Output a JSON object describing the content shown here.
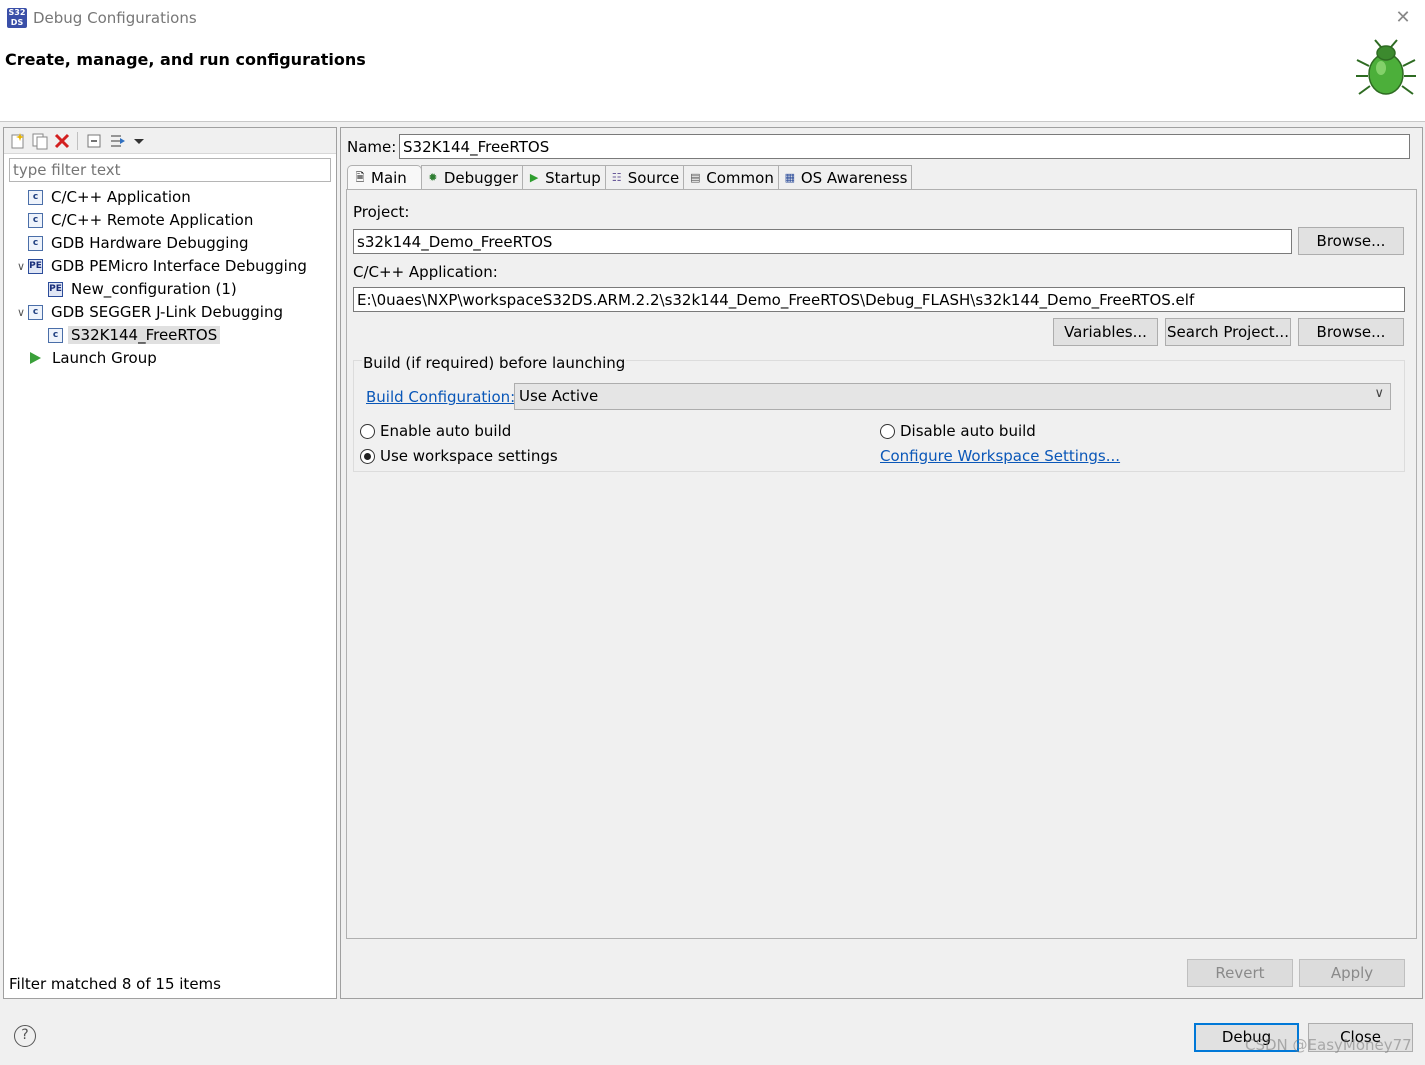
{
  "window": {
    "title": "Debug Configurations",
    "header_title": "Create, manage, and run configurations"
  },
  "left": {
    "filter_placeholder": "type filter text",
    "tree": [
      {
        "label": "C/C++ Application",
        "icon": "c-config-icon"
      },
      {
        "label": "C/C++ Remote Application",
        "icon": "c-config-icon"
      },
      {
        "label": "GDB Hardware Debugging",
        "icon": "c-config-icon"
      },
      {
        "label": "GDB PEMicro Interface Debugging",
        "icon": "pemicro-icon",
        "expanded": true
      },
      {
        "label": "New_configuration (1)",
        "icon": "pemicro-icon"
      },
      {
        "label": "GDB SEGGER J-Link Debugging",
        "icon": "c-config-icon",
        "expanded": true
      },
      {
        "label": "S32K144_FreeRTOS",
        "icon": "c-config-icon",
        "selected": true
      },
      {
        "label": "Launch Group",
        "icon": "launch-group-icon"
      }
    ],
    "status": "Filter matched 8 of 15 items"
  },
  "right": {
    "name_label": "Name:",
    "name_value": "S32K144_FreeRTOS",
    "tabs": [
      "Main",
      "Debugger",
      "Startup",
      "Source",
      "Common",
      "OS Awareness"
    ],
    "active_tab": "Main",
    "main": {
      "project_label": "Project:",
      "project_value": "s32k144_Demo_FreeRTOS",
      "browse_label": "Browse...",
      "app_label": "C/C++ Application:",
      "app_value": "E:\\0uaes\\NXP\\workspaceS32DS.ARM.2.2\\s32k144_Demo_FreeRTOS\\Debug_FLASH\\s32k144_Demo_FreeRTOS.elf",
      "variables_label": "Variables...",
      "search_project_label": "Search Project...",
      "browse2_label": "Browse...",
      "build_group_title": "Build (if required) before launching",
      "build_config_link": "Build Configuration:",
      "build_config_value": "Use Active",
      "enable_auto_build": "Enable auto build",
      "disable_auto_build": "Disable auto build",
      "use_workspace_settings": "Use workspace settings",
      "configure_workspace_link": "Configure Workspace Settings..."
    },
    "revert_label": "Revert",
    "apply_label": "Apply"
  },
  "footer": {
    "debug_label": "Debug",
    "close_label": "Close",
    "watermark": "CSDN @EasyMoney77"
  },
  "colors": {
    "link": "#0a57b8",
    "default_button_border": "#0078d7"
  }
}
